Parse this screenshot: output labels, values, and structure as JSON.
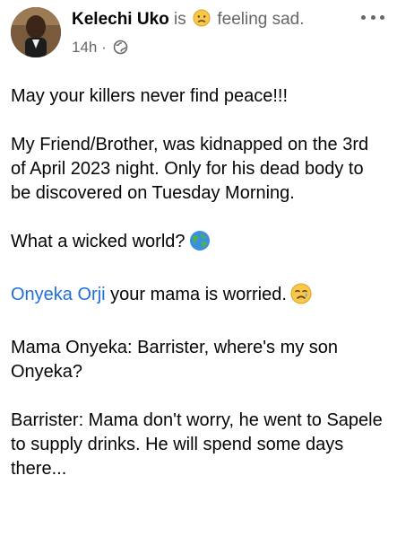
{
  "post": {
    "author": "Kelechi Uko",
    "feeling_prefix": "is",
    "feeling_emoji": "sad-face-emoji",
    "feeling_text": "feeling sad.",
    "time": "14h",
    "separator": "·",
    "audience_icon": "globe-icon",
    "menu_icon": "more-options-icon"
  },
  "content": {
    "line1": "May your killers never find peace!!!",
    "para2": "My Friend/Brother, was kidnapped on the 3rd of April 2023 night. Only for his dead body to be discovered on Tuesday Morning.",
    "para3": "What a wicked world?",
    "para3_emoji": "globe-emoji",
    "mention": "Onyeka Orji",
    "para4_rest": " your mama is worried.",
    "para4_emoji": "crying-face-emoji",
    "para5": "Mama Onyeka: Barrister, where's my son Onyeka?",
    "para6": "Barrister: Mama don't worry, he went to Sapele to supply drinks. He will spend some days there..."
  },
  "colors": {
    "mention": "#216fdb",
    "muted": "#65676b",
    "text": "#050505"
  }
}
